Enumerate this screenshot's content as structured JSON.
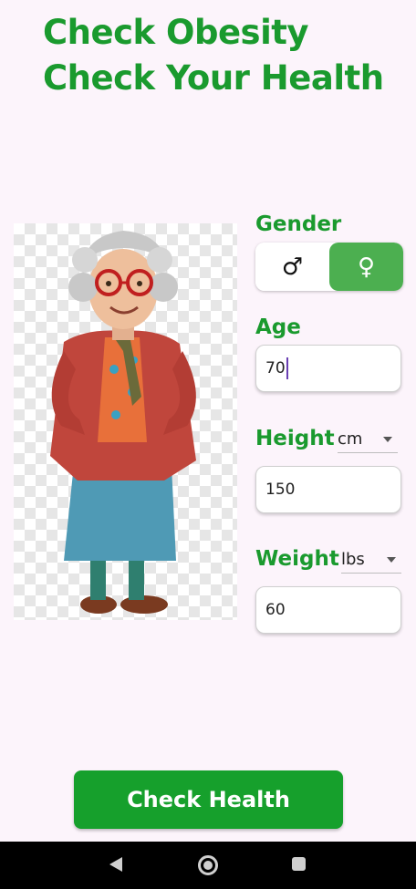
{
  "header": {
    "title_line1": "Check Obesity",
    "title_line2": "Check Your Health"
  },
  "illustration": {
    "subject": "cartoon grandmother with red glasses"
  },
  "gender": {
    "label": "Gender",
    "male_icon": "♂",
    "female_icon": "♀",
    "selected": "female"
  },
  "age": {
    "label": "Age",
    "value": "70"
  },
  "height": {
    "label": "Height",
    "unit": "cm",
    "value": "150"
  },
  "weight": {
    "label": "Weight",
    "unit": "lbs",
    "value": "60"
  },
  "action": {
    "check_label": "Check Health"
  },
  "colors": {
    "accent": "#1a9a2e",
    "button": "#16a02c",
    "selected": "#4caf50"
  },
  "navbar": {
    "icons": [
      "back-icon",
      "home-icon",
      "recents-icon"
    ]
  }
}
